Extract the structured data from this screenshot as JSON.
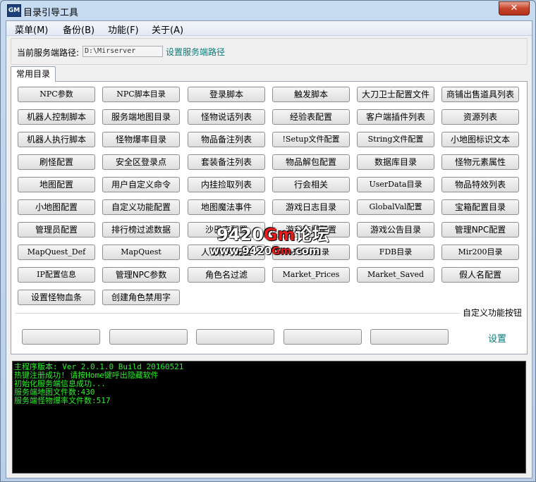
{
  "window": {
    "icon_text": "GM",
    "title": "目录引导工具",
    "close_label": "✕"
  },
  "menu": [
    {
      "label": "菜单(M)"
    },
    {
      "label": "备份(B)"
    },
    {
      "label": "功能(F)"
    },
    {
      "label": "关于(A)"
    }
  ],
  "server_path": {
    "label": "当前服务端路径:",
    "value": "D:\\Mirserver",
    "set_label": "设置服务端路径"
  },
  "tab": {
    "label": "常用目录"
  },
  "buttons": [
    [
      "NPC参数",
      "NPC脚本目录",
      "登录脚本",
      "触发脚本",
      "大刀卫士配置文件",
      "商铺出售道具列表"
    ],
    [
      "机器人控制脚本",
      "服务端地图目录",
      "怪物说话列表",
      "经验表配置",
      "客户端插件列表",
      "资源列表"
    ],
    [
      "机器人执行脚本",
      "怪物爆率目录",
      "物品备注列表",
      "!Setup文件配置",
      "String文件配置",
      "小地图标识文本"
    ],
    [
      "刷怪配置",
      "安全区登录点",
      "套装备注列表",
      "物品解包配置",
      "数据库目录",
      "怪物元素属性"
    ],
    [
      "地图配置",
      "用户自定义命令",
      "内挂捡取列表",
      "行会相关",
      "UserData目录",
      "物品特效列表"
    ],
    [
      "小地图配置",
      "自定义功能配置",
      "地图魔法事件",
      "游戏日志目录",
      "GlobalVal配置",
      "宝箱配置目录"
    ],
    [
      "管理员配置",
      "排行榜过滤数据",
      "沙巴克配置",
      "游戏商城配置",
      "游戏公告目录",
      "管理NPC配置"
    ],
    [
      "MapQuest_Def",
      "MapQuest",
      "人物称号配置",
      "Envir目录",
      "FDB目录",
      "Mir200目录"
    ],
    [
      "IP配置信息",
      "管理NPC参数",
      "角色名过滤",
      "Market_Prices",
      "Market_Saved",
      "假人名配置"
    ],
    [
      "设置怪物血条",
      "创建角色禁用字"
    ]
  ],
  "custom": {
    "label": "自定义功能按钮",
    "set_label": "设置"
  },
  "log": [
    "主程序版本: Ver 2.0.1.0 Build 20160521",
    "热键注册成功! 请按Home键呼出隐藏软件",
    "初始化服务端信息成功...",
    "服务端地图文件数:430",
    "服务端怪物爆率文件数:517"
  ],
  "watermark": {
    "line1_a": "9420",
    "line1_b": "Gm",
    "line1_c": "论坛",
    "line2_a": "www.9420",
    "line2_b": "Gm",
    "line2_c": ".com"
  },
  "colors": {
    "link": "#0a7a7a",
    "log_text": "#2cf02c",
    "console_bg": "#000000"
  }
}
